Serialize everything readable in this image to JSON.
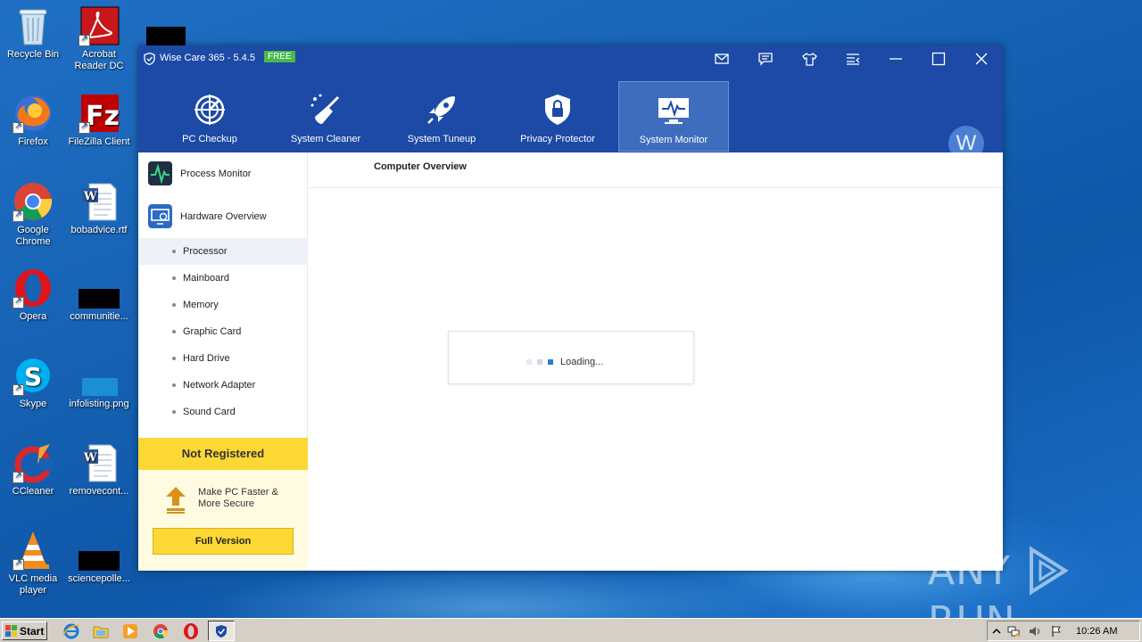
{
  "desktop": {
    "icons": [
      {
        "label": "Recycle Bin"
      },
      {
        "label": "Acrobat Reader DC"
      },
      {
        "label": "Firefox"
      },
      {
        "label": "FileZilla Client"
      },
      {
        "label": "Google Chrome"
      },
      {
        "label": "bobadvice.rtf"
      },
      {
        "label": "Opera"
      },
      {
        "label": "communitie..."
      },
      {
        "label": "Skype"
      },
      {
        "label": "infolisting.png"
      },
      {
        "label": "CCleaner"
      },
      {
        "label": "removecont..."
      },
      {
        "label": "VLC media player"
      },
      {
        "label": "sciencepolle..."
      }
    ]
  },
  "window": {
    "title": "Wise Care 365 - 5.4.5",
    "badge": "FREE",
    "nav": [
      {
        "label": "PC Checkup",
        "icon": "crosshair-icon"
      },
      {
        "label": "System Cleaner",
        "icon": "broom-icon"
      },
      {
        "label": "System Tuneup",
        "icon": "rocket-icon"
      },
      {
        "label": "Privacy Protector",
        "icon": "shield-lock-icon"
      },
      {
        "label": "System Monitor",
        "icon": "monitor-pulse-icon",
        "active": true
      }
    ],
    "avatar_letter": "W",
    "sidebar": {
      "sections": [
        {
          "label": "Process Monitor",
          "icon": "pulse-icon"
        },
        {
          "label": "Hardware Overview",
          "icon": "hardware-icon"
        }
      ],
      "sub_items": [
        "Processor",
        "Mainboard",
        "Memory",
        "Graphic Card",
        "Hard Drive",
        "Network Adapter",
        "Sound Card"
      ],
      "selected_sub_item": "Processor"
    },
    "promo": {
      "title": "Not Registered",
      "text_line1": "Make PC Faster &",
      "text_line2": "More Secure",
      "button": "Full Version"
    },
    "content": {
      "title": "Computer Overview",
      "loading_text": "Loading..."
    }
  },
  "watermark": {
    "left": "ANY",
    "right": "RUN"
  },
  "taskbar": {
    "start_label": "Start",
    "clock": "10:26 AM"
  },
  "colors": {
    "app_header": "#1c4aa6",
    "nav_active": "#3f6dbe",
    "promo_yellow": "#fdd835",
    "badge_green": "#49b94a"
  }
}
